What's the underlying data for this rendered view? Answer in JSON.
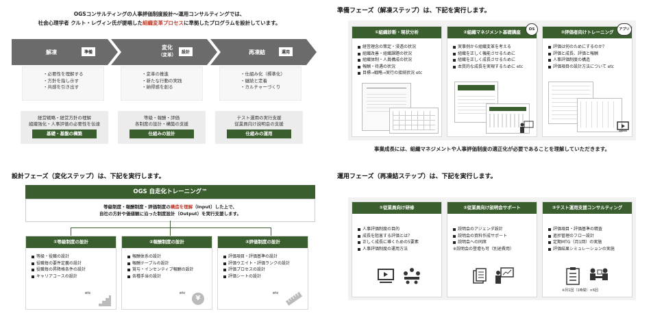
{
  "intro": {
    "line1": "OGSコンサルティングの人事評価制度設計～運用コンサルティングでは、",
    "line2a": "社会心理学者 クルト・レヴィン氏が提唱した",
    "line2b": "組織変革プロセス",
    "line2c": "に準拠したプログラムを設計しています。"
  },
  "phases": [
    {
      "name": "解凍",
      "sub": "",
      "tag": "準備",
      "points": [
        "・必要性を理解する",
        "・方針を指し示す",
        "・共感を引き出す"
      ],
      "desc1": "経営戦略・経営方針の理解",
      "desc2": "組織強化・人事評価の必要性を伝達",
      "btn": "基礎・基盤の構築"
    },
    {
      "name": "変化",
      "sub": "（変革）",
      "tag": "設計",
      "points": [
        "・変革の推進",
        "・新たな行動の実践",
        "・納得感を創る"
      ],
      "desc1": "等級・報酬・評価",
      "desc2": "各制度の設計・構築の支援",
      "btn": "仕組みの設計"
    },
    {
      "name": "再凍結",
      "sub": "",
      "tag": "運用",
      "points": [
        "・仕組み化（標準化）",
        "・継続と定着",
        "・カルチャーづくり"
      ],
      "desc1": "テスト運用の実行支援",
      "desc2": "従業員向け説明会の支援",
      "btn": "仕組みの運用"
    }
  ],
  "prep": {
    "heading": "準備フェーズ（解凍ステップ）は、下記を実行します。",
    "cards": [
      {
        "title": "①組織診断・現状分析",
        "badge": "",
        "items": [
          "経営理念の策定・浸透の状況",
          "組織改善・組織課題の状況",
          "組織体制・人員構成の状況",
          "報酬・待遇の状況",
          "目標→戦略→実行の接続状況  etc"
        ]
      },
      {
        "title": "②組織マネジメント基礎講座",
        "badge": "OS",
        "items": [
          "実事例から組織変革を考える",
          "組織を正しく機能させるために",
          "組織を正しく成長させるために",
          "本質的な成長を実現するために  etc"
        ]
      },
      {
        "title": "③評価者向けトレーニング",
        "badge": "アプリ",
        "items": [
          "評価は何のためにするのか？",
          "評価と成長、評価と報酬",
          "人事評価制度の構造",
          "評価項目の設計方法について  etc"
        ]
      }
    ],
    "footer": "事業成長には、組織マネジメントや人事評価制度の適正化が必要であることを理解していただきます。"
  },
  "design": {
    "heading": "設計フェーズ（変化ステップ）は、下記を実行します。",
    "title": "OGS 自走化トレーニング™",
    "desc1a": "等級制度・報酬制度・評価制度の",
    "desc1b": "構造を理解",
    "desc1c": "（Input）した上で、",
    "desc2": "自社の方針や価値観に沿った制度設計（Output）を実行支援します。",
    "cards": [
      {
        "title": "①等級制度の設計",
        "items": [
          "等級・役職の設計",
          "役職毎の要件定義の設計",
          "役職毎の昇降格条件の設計",
          "キャリアコースの設計"
        ],
        "etc": "etc"
      },
      {
        "title": "②報酬制度の設計",
        "items": [
          "報酬体系の設計",
          "報酬テーブルの設計",
          "賞与・インセンティブ報酬の設計",
          "各種手当の設計"
        ],
        "etc": "etc"
      },
      {
        "title": "③評価制度の設計",
        "items": [
          "評価項目・評価基準の設計",
          "評価ウエイト・評価ランクの設計",
          "評価プロセスの設計",
          "評価シートの設計"
        ],
        "etc": "etc"
      }
    ]
  },
  "ops": {
    "heading": "運用フェーズ（再凍結ステップ）は、下記を実行します。",
    "cards": [
      {
        "title": "①従業員向け研修",
        "items": [
          "人事評価制度の目的",
          "成長を阻害する評価とは？",
          "正しく成長に導くための5要素",
          "人事評価制度の運用方法"
        ],
        "note": ""
      },
      {
        "title": "②従業員向け説明会サポート",
        "items": [
          "説明会のアジェンダ設計",
          "説明会の資料作成サポート",
          "説明会への同席"
        ],
        "extra": "※説明会の登壇も可（別途費用）",
        "note": ""
      },
      {
        "title": "③テスト運用支援コンサルティング",
        "items": [
          "評価項目・評価基準の精査",
          "進捗管理のフロー設計",
          "定期MTG（月1回）の実施",
          "評価結果シミュレーションの実施"
        ],
        "note": "※月1回（1時間）×6回"
      }
    ]
  },
  "icons": {
    "yen": "¥",
    "os": "OS",
    "app": "アプリ"
  }
}
